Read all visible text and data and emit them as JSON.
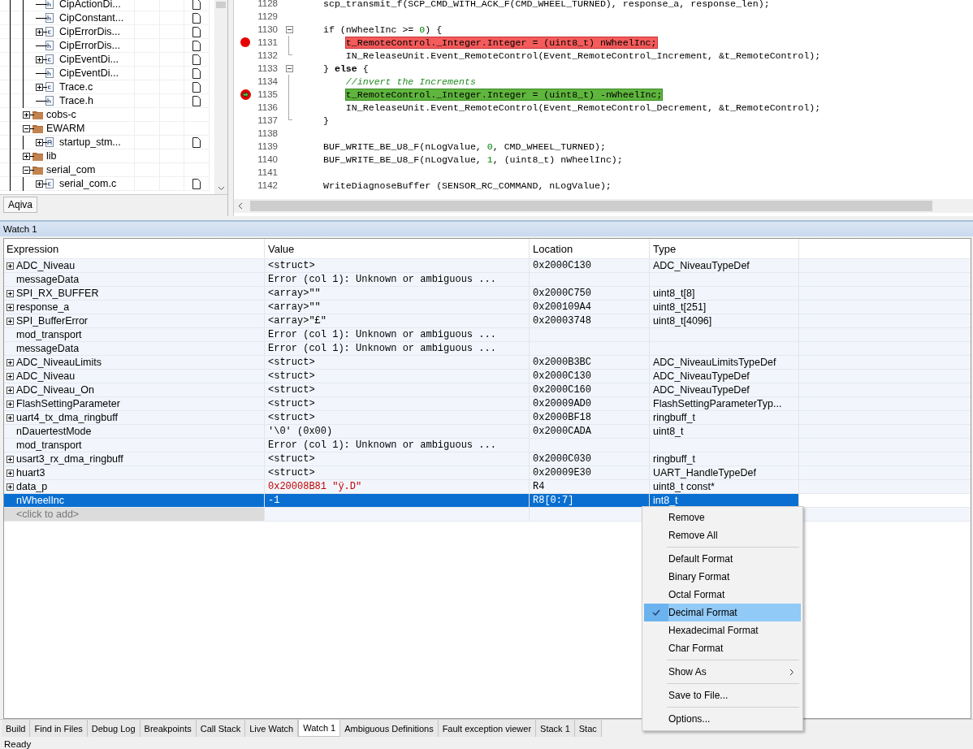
{
  "tree": {
    "files_above": [
      {
        "label": "CipActionDi...",
        "kind": "h",
        "expandable": false
      },
      {
        "label": "CipConstant...",
        "kind": "h",
        "expandable": false
      },
      {
        "label": "CipErrorDis...",
        "kind": "c",
        "expandable": true
      },
      {
        "label": "CipErrorDis...",
        "kind": "h",
        "expandable": false
      },
      {
        "label": "CipEventDi...",
        "kind": "c",
        "expandable": true
      },
      {
        "label": "CipEventDi...",
        "kind": "h",
        "expandable": false
      },
      {
        "label": "Trace.c",
        "kind": "c",
        "expandable": true
      },
      {
        "label": "Trace.h",
        "kind": "h",
        "expandable": false
      }
    ],
    "folders": [
      {
        "label": "cobs-c",
        "expanded": false
      },
      {
        "label": "EWARM",
        "expanded": true,
        "children": [
          {
            "label": "startup_stm...",
            "kind": "asm",
            "expandable": true
          }
        ]
      },
      {
        "label": "lib",
        "expanded": false
      },
      {
        "label": "serial_com",
        "expanded": true,
        "children": [
          {
            "label": "serial_com.c",
            "kind": "c",
            "expandable": true
          }
        ]
      }
    ],
    "tabs": [
      {
        "label": "Aqiva",
        "selected": true
      }
    ]
  },
  "editor": {
    "lines": [
      {
        "number": "1128",
        "fold_start": false,
        "fold_end": false,
        "breakpoint": false,
        "current": false,
        "segments": [
          {
            "kind": "plain",
            "text": "scp_transmit_f(SCP_CMD_WITH_ACK_F(CMD_WHEEL_TURNED), response_a, response_len);"
          }
        ]
      },
      {
        "number": "1129",
        "fold_start": false,
        "fold_end": false,
        "breakpoint": false,
        "current": false
      },
      {
        "number": "1130",
        "fold_start": true,
        "fold_end": false,
        "breakpoint": false,
        "current": false,
        "segments": [
          {
            "kind": "plain",
            "text": "if (nWheelInc >= "
          },
          {
            "kind": "number",
            "text": "0"
          },
          {
            "kind": "plain",
            "text": ") {"
          }
        ]
      },
      {
        "number": "1131",
        "fold_start": false,
        "fold_end": false,
        "breakpoint": true,
        "current": false,
        "segments": [
          {
            "kind": "plain",
            "text": "    t_RemoteControl._Integer.Integer = (uint8_t) nWheelInc;"
          }
        ]
      },
      {
        "number": "1132",
        "fold_start": false,
        "fold_end": true,
        "breakpoint": false,
        "current": false,
        "segments": [
          {
            "kind": "plain",
            "text": "    IN_ReleaseUnit.Event_RemoteControl(Event_RemoteControl_Increment, &t_RemoteControl);"
          }
        ]
      },
      {
        "number": "1133",
        "fold_start": true,
        "fold_end": false,
        "breakpoint": false,
        "current": false,
        "segments": [
          {
            "kind": "plain",
            "text": "} "
          },
          {
            "kind": "keyword",
            "text": "else"
          },
          {
            "kind": "plain",
            "text": " {"
          }
        ]
      },
      {
        "number": "1134",
        "fold_start": false,
        "fold_end": false,
        "breakpoint": false,
        "current": false,
        "segments": [
          {
            "kind": "comment",
            "text": "    //invert the Increments"
          }
        ]
      },
      {
        "number": "1135",
        "fold_start": false,
        "fold_end": false,
        "breakpoint": false,
        "current": true,
        "segments": [
          {
            "kind": "plain",
            "text": "    t_RemoteControl._Integer.Integer = (uint8_t) -nWheelInc;"
          }
        ]
      },
      {
        "number": "1136",
        "fold_start": false,
        "fold_end": false,
        "breakpoint": false,
        "current": false,
        "segments": [
          {
            "kind": "plain",
            "text": "    IN_ReleaseUnit.Event_RemoteControl(Event_RemoteControl_Decrement, &t_RemoteControl);"
          }
        ]
      },
      {
        "number": "1137",
        "fold_start": false,
        "fold_end": true,
        "breakpoint": false,
        "current": false,
        "segments": [
          {
            "kind": "plain",
            "text": "}"
          }
        ]
      },
      {
        "number": "1138",
        "fold_start": false,
        "fold_end": false,
        "breakpoint": false,
        "current": false
      },
      {
        "number": "1139",
        "fold_start": false,
        "fold_end": false,
        "breakpoint": false,
        "current": false,
        "segments": [
          {
            "kind": "plain",
            "text": "BUF_WRITE_BE_U8_F(nLogValue, "
          },
          {
            "kind": "number",
            "text": "0"
          },
          {
            "kind": "plain",
            "text": ", CMD_WHEEL_TURNED);"
          }
        ]
      },
      {
        "number": "1140",
        "fold_start": false,
        "fold_end": false,
        "breakpoint": false,
        "current": false,
        "segments": [
          {
            "kind": "plain",
            "text": "BUF_WRITE_BE_U8_F(nLogValue, "
          },
          {
            "kind": "number",
            "text": "1"
          },
          {
            "kind": "plain",
            "text": ", (uint8_t) nWheelInc);"
          }
        ]
      },
      {
        "number": "1141",
        "fold_start": false,
        "fold_end": false,
        "breakpoint": false,
        "current": false
      },
      {
        "number": "1142",
        "fold_start": false,
        "fold_end": false,
        "breakpoint": false,
        "current": false,
        "segments": [
          {
            "kind": "plain",
            "text": "WriteDiagnoseBuffer (SENSOR_RC_COMMAND, nLogValue);"
          }
        ]
      }
    ]
  },
  "watch": {
    "title": "Watch 1",
    "columns": [
      "Expression",
      "Value",
      "Location",
      "Type"
    ],
    "rows": [
      {
        "expandable": true,
        "expression": "ADC_Niveau",
        "value": "<struct>",
        "changed": false,
        "location": "0x2000C130",
        "type": "ADC_NiveauTypeDef",
        "selected": false
      },
      {
        "expandable": false,
        "expression": "messageData",
        "value": "Error (col 1): Unknown or ambiguous ...",
        "changed": false,
        "selected": false
      },
      {
        "expandable": true,
        "expression": "SPI_RX_BUFFER",
        "value": "<array>\"\"",
        "changed": false,
        "location": "0x2000C750",
        "type": "uint8_t[8]",
        "selected": false
      },
      {
        "expandable": true,
        "expression": "response_a",
        "value": "<array>\"\"",
        "changed": false,
        "location": "0x200109A4",
        "type": "uint8_t[251]",
        "selected": false
      },
      {
        "expandable": true,
        "expression": "SPI_BufferError",
        "value": "<array>\"£\"",
        "changed": false,
        "location": "0x20003748",
        "type": "uint8_t[4096]",
        "selected": false
      },
      {
        "expandable": false,
        "expression": "mod_transport",
        "value": "Error (col 1): Unknown or ambiguous ...",
        "changed": false,
        "selected": false
      },
      {
        "expandable": false,
        "expression": "messageData",
        "value": "Error (col 1): Unknown or ambiguous ...",
        "changed": false,
        "selected": false
      },
      {
        "expandable": true,
        "expression": "ADC_NiveauLimits",
        "value": "<struct>",
        "changed": false,
        "location": "0x2000B3BC",
        "type": "ADC_NiveauLimitsTypeDef",
        "selected": false
      },
      {
        "expandable": true,
        "expression": "ADC_Niveau",
        "value": "<struct>",
        "changed": false,
        "location": "0x2000C130",
        "type": "ADC_NiveauTypeDef",
        "selected": false
      },
      {
        "expandable": true,
        "expression": "ADC_Niveau_On",
        "value": "<struct>",
        "changed": false,
        "location": "0x2000C160",
        "type": "ADC_NiveauTypeDef",
        "selected": false
      },
      {
        "expandable": true,
        "expression": "FlashSettingParameter",
        "value": "<struct>",
        "changed": false,
        "location": "0x20009AD0",
        "type": "FlashSettingParameterTyp...",
        "selected": false
      },
      {
        "expandable": true,
        "expression": "uart4_tx_dma_ringbuff",
        "value": "<struct>",
        "changed": false,
        "location": "0x2000BF18",
        "type": "ringbuff_t",
        "selected": false
      },
      {
        "expandable": false,
        "expression": "nDauertestMode",
        "value": "'\\0' (0x00)",
        "changed": false,
        "location": "0x2000CADA",
        "type": "uint8_t",
        "selected": false
      },
      {
        "expandable": false,
        "expression": "mod_transport",
        "value": "Error (col 1): Unknown or ambiguous ...",
        "changed": false,
        "selected": false
      },
      {
        "expandable": true,
        "expression": "usart3_rx_dma_ringbuff",
        "value": "<struct>",
        "changed": false,
        "location": "0x2000C030",
        "type": "ringbuff_t",
        "selected": false
      },
      {
        "expandable": true,
        "expression": "huart3",
        "value": "<struct>",
        "changed": false,
        "location": "0x20009E30",
        "type": "UART_HandleTypeDef",
        "selected": false
      },
      {
        "expandable": true,
        "expression": "data_p",
        "value": "0x20008B81 \"ÿ.D\"",
        "changed": true,
        "location": "R4",
        "type": "uint8_t const*",
        "selected": false
      },
      {
        "expandable": false,
        "expression": "nWheelInc",
        "value": "-1",
        "changed": false,
        "location": "R8[0:7]",
        "type": "int8_t",
        "selected": true
      }
    ],
    "add_row": {
      "placeholder": "<click to add>"
    }
  },
  "context_menu": {
    "items": [
      {
        "kind": "item",
        "label": "Remove",
        "checked": false,
        "selected": false,
        "submenu": false
      },
      {
        "kind": "item",
        "label": "Remove All",
        "checked": false,
        "selected": false,
        "submenu": false
      },
      {
        "kind": "separator"
      },
      {
        "kind": "item",
        "label": "Default Format",
        "checked": false,
        "selected": false,
        "submenu": false
      },
      {
        "kind": "item",
        "label": "Binary Format",
        "checked": false,
        "selected": false,
        "submenu": false
      },
      {
        "kind": "item",
        "label": "Octal Format",
        "checked": false,
        "selected": false,
        "submenu": false
      },
      {
        "kind": "item",
        "label": "Decimal Format",
        "checked": true,
        "selected": true,
        "submenu": false
      },
      {
        "kind": "item",
        "label": "Hexadecimal Format",
        "checked": false,
        "selected": false,
        "submenu": false
      },
      {
        "kind": "item",
        "label": "Char Format",
        "checked": false,
        "selected": false,
        "submenu": false
      },
      {
        "kind": "separator"
      },
      {
        "kind": "item",
        "label": "Show As",
        "checked": false,
        "selected": false,
        "submenu": true
      },
      {
        "kind": "separator"
      },
      {
        "kind": "item",
        "label": "Save to File...",
        "checked": false,
        "selected": false,
        "submenu": false
      },
      {
        "kind": "separator"
      },
      {
        "kind": "item",
        "label": "Options...",
        "checked": false,
        "selected": false,
        "submenu": false
      }
    ]
  },
  "bottom_tabs": [
    {
      "label": "Build",
      "selected": false
    },
    {
      "label": "Find in Files",
      "selected": false
    },
    {
      "label": "Debug Log",
      "selected": false
    },
    {
      "label": "Breakpoints",
      "selected": false
    },
    {
      "label": "Call Stack",
      "selected": false
    },
    {
      "label": "Live Watch",
      "selected": false
    },
    {
      "label": "Watch 1",
      "selected": true
    },
    {
      "label": "Ambiguous Definitions",
      "selected": false
    },
    {
      "label": "Fault exception viewer",
      "selected": false
    },
    {
      "label": "Stack 1",
      "selected": false
    },
    {
      "label": "Stac",
      "selected": false
    }
  ],
  "status_bar": {
    "text": "Ready"
  }
}
